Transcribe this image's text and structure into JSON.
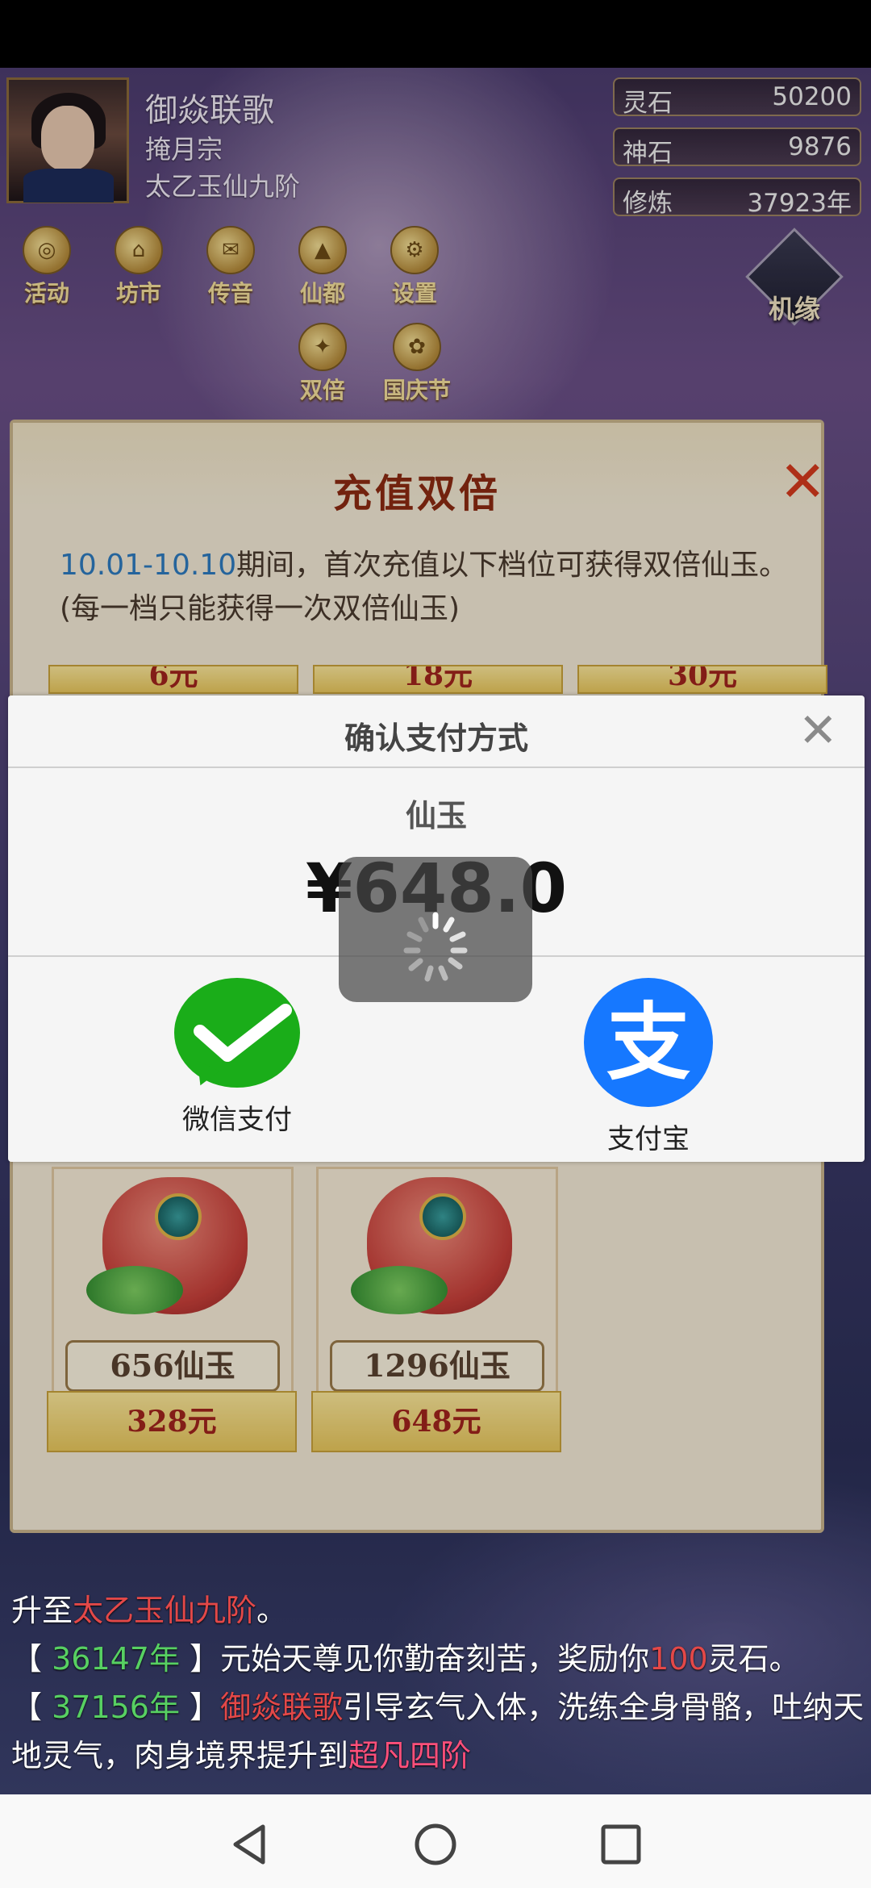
{
  "player": {
    "name": "御焱联歌",
    "sect": "掩月宗",
    "realm": "太乙玉仙九阶"
  },
  "resources": [
    {
      "label": "灵石",
      "value": "50200"
    },
    {
      "label": "神石",
      "value": "9876"
    },
    {
      "label": "修炼",
      "value": "37923年"
    }
  ],
  "top_menu": [
    {
      "label": "活动",
      "icon": "coin-icon"
    },
    {
      "label": "坊市",
      "icon": "market-icon"
    },
    {
      "label": "传音",
      "icon": "envelope-icon"
    },
    {
      "label": "仙都",
      "icon": "pagoda-icon"
    },
    {
      "label": "设置",
      "icon": "gear-icon"
    }
  ],
  "second_menu": [
    {
      "label": "双倍",
      "icon": "double-icon"
    },
    {
      "label": "国庆节",
      "icon": "lantern-icon"
    }
  ],
  "jiyuan": {
    "label": "机缘"
  },
  "event_dialog": {
    "title": "充值双倍",
    "desc_highlight": "10.01-10.10",
    "desc_rest": "期间，首次充值以下档位可获得双倍仙玉。(每一档只能获得一次双倍仙玉)",
    "top_tiers": [
      "6元",
      "18元",
      "30元"
    ],
    "cards": [
      {
        "reward": "656仙玉",
        "price": "328元"
      },
      {
        "reward": "1296仙玉",
        "price": "648元"
      }
    ]
  },
  "payment": {
    "title": "确认支付方式",
    "product": "仙玉",
    "amount": "¥648.0",
    "methods": [
      {
        "name": "微信支付",
        "icon": "wechat-pay-icon"
      },
      {
        "name": "支付宝",
        "icon": "alipay-icon",
        "glyph": "支"
      }
    ]
  },
  "log": {
    "line1_pre": "升至",
    "line1_realm": "太乙玉仙九阶",
    "line1_post": "。",
    "line2_year": "36147年",
    "line2_pre": "元始天尊见你勤奋刻苦，奖励你",
    "line2_num": "100",
    "line2_post": "灵石。",
    "line3_year": "37156年",
    "line3_name": "御焱联歌",
    "line3_text": "引导玄气入体，洗练全身骨骼，吐纳天地灵气，肉身境界提升到",
    "line3_level": "超凡四阶"
  },
  "colors": {
    "wechat": "#1aad19",
    "alipay": "#1678ff",
    "title_red": "#8c2a12",
    "highlight_blue": "#2e7bbf"
  }
}
